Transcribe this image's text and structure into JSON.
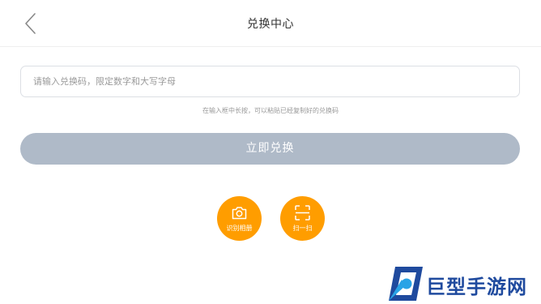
{
  "header": {
    "title": "兑换中心",
    "back_icon": "chevron-left-icon"
  },
  "form": {
    "input_placeholder": "请输入兑换码，限定数字和大写字母",
    "input_value": "",
    "hint": "在输入框中长按，可以粘贴已经复制好的兑换码",
    "redeem_label": "立即兑换"
  },
  "actions": [
    {
      "label": "识别相册",
      "icon": "camera-icon"
    },
    {
      "label": "扫一扫",
      "icon": "scan-icon"
    }
  ],
  "watermark": {
    "text": "巨型手游网"
  },
  "colors": {
    "accent": "#ff9d00",
    "button_disabled": "#afbac8",
    "watermark": "#1f4a9e"
  }
}
